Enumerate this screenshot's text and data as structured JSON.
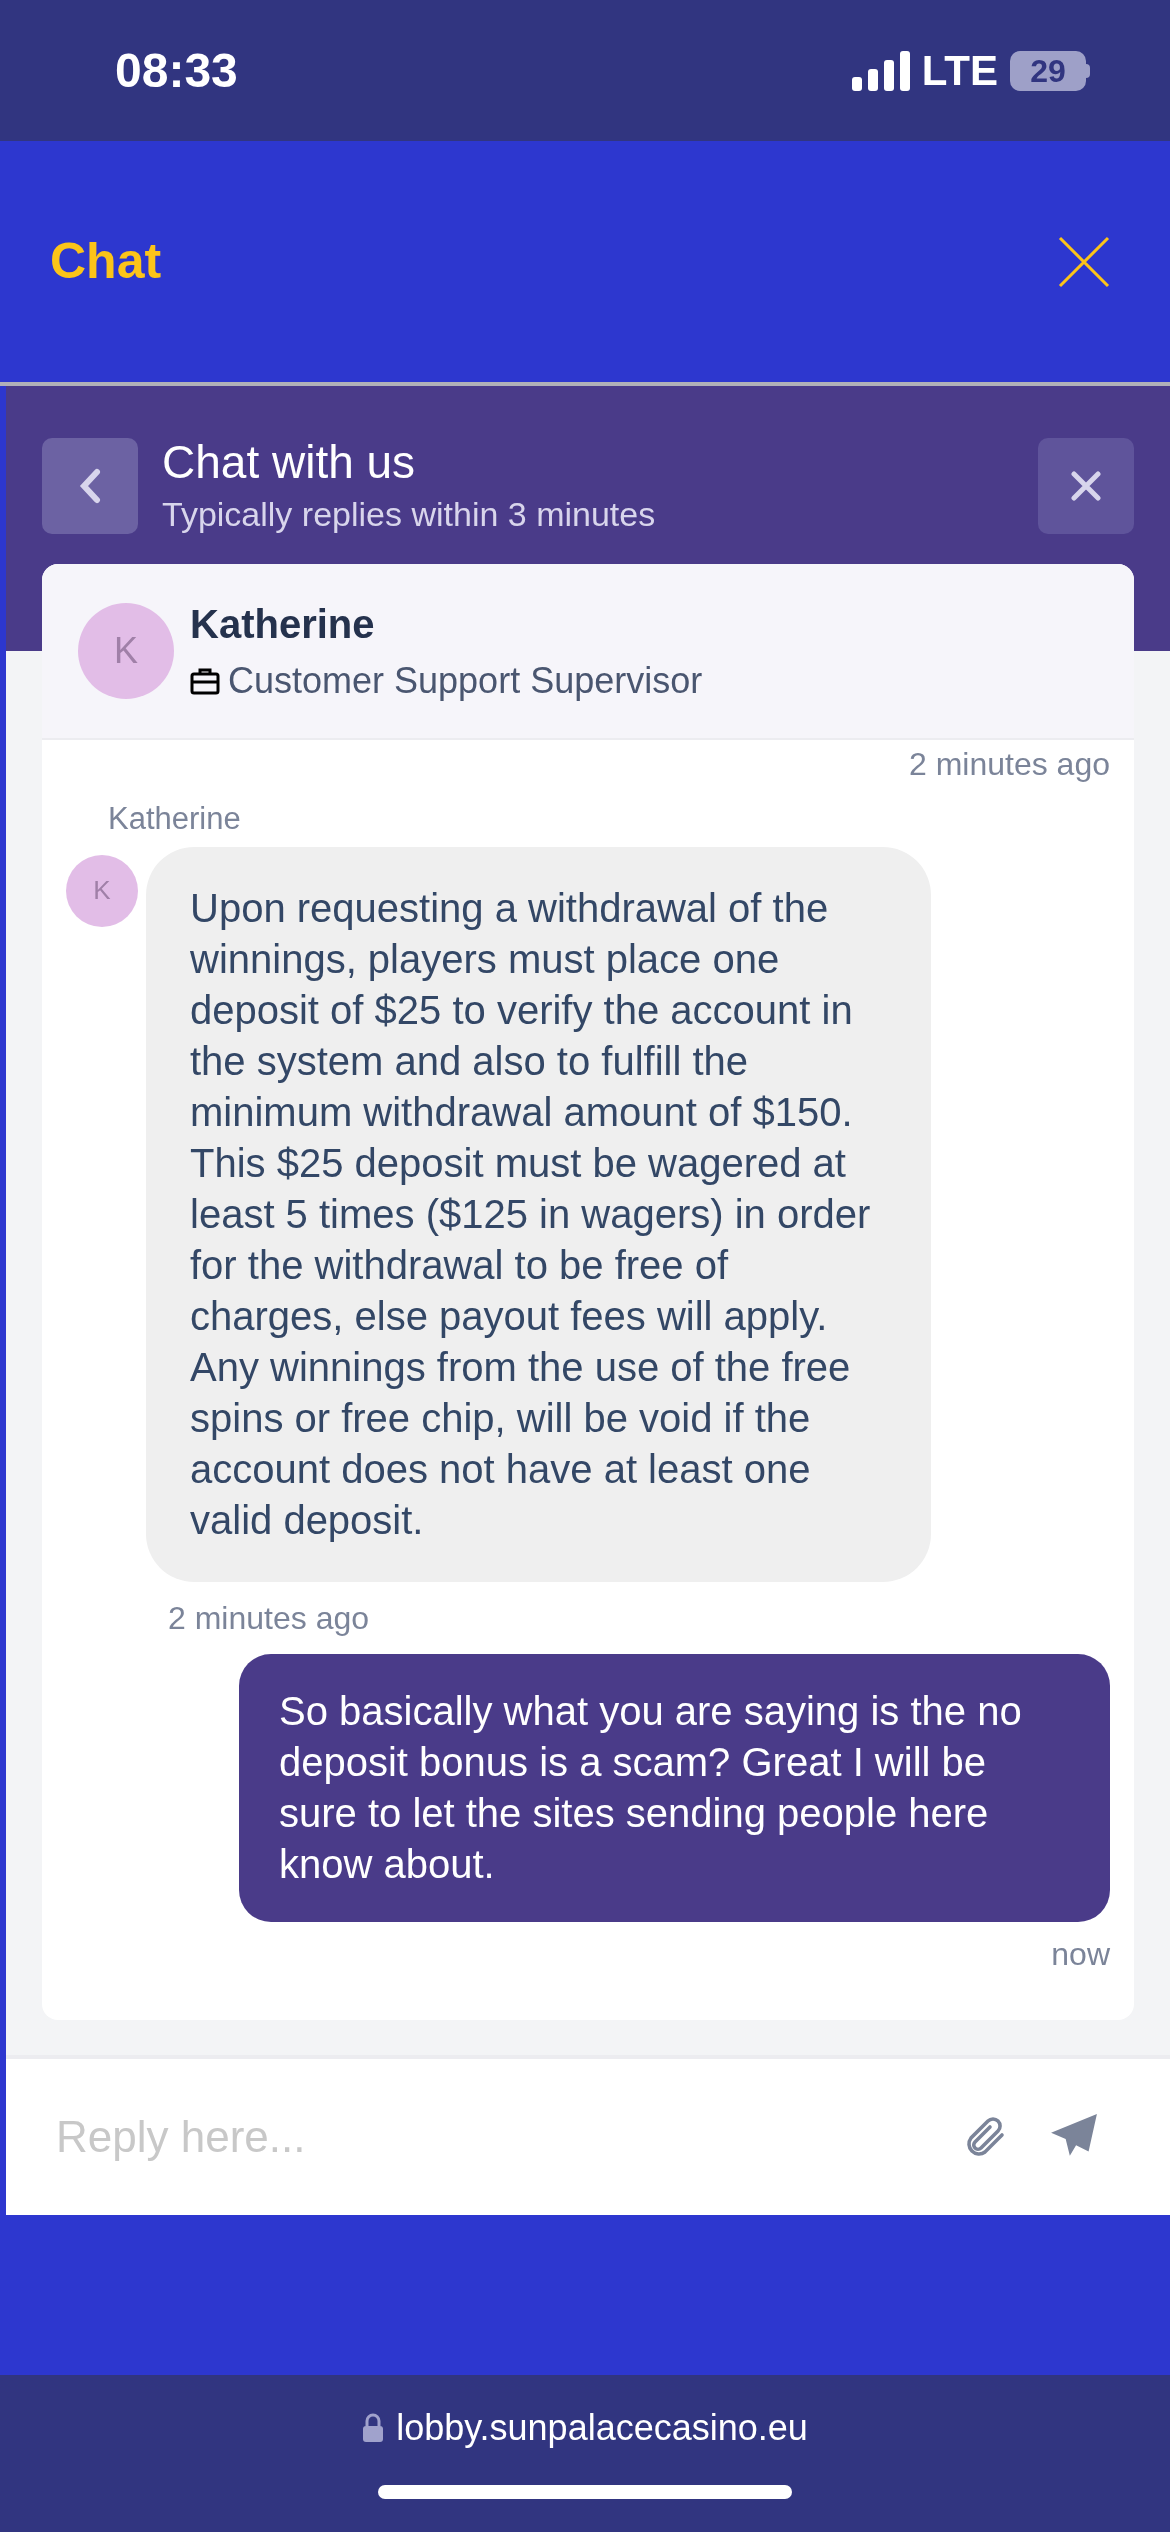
{
  "status_bar": {
    "time": "08:33",
    "network": "LTE",
    "battery": "29"
  },
  "app_header": {
    "title": "Chat"
  },
  "chat_panel": {
    "title": "Chat with us",
    "subtitle": "Typically replies within 3 minutes"
  },
  "agent": {
    "initial": "K",
    "name": "Katherine",
    "role": "Customer Support Supervisor"
  },
  "messages": [
    {
      "kind": "timestamp",
      "text": "2 minutes ago"
    },
    {
      "kind": "incoming",
      "sender": "Katherine",
      "initial": "K",
      "text": "Upon requesting a withdrawal of the winnings, players must place one deposit of $25 to verify the account in the system and also to fulfill the minimum withdrawal amount of $150. This $25 deposit must be wagered at least 5 times ($125 in wagers) in order for the withdrawal to be free of charges, else payout fees will apply. Any winnings from the use of the free spins or free chip, will be void if the account does not have at least one valid deposit.",
      "time": "2 minutes ago"
    },
    {
      "kind": "outgoing",
      "text": "So basically what you are saying is the no deposit bonus is a scam? Great I will be sure to let the sites sending people here know about.",
      "time": "now"
    }
  ],
  "composer": {
    "placeholder": "Reply here..."
  },
  "browser_bar": {
    "url": "lobby.sunpalacecasino.eu"
  }
}
